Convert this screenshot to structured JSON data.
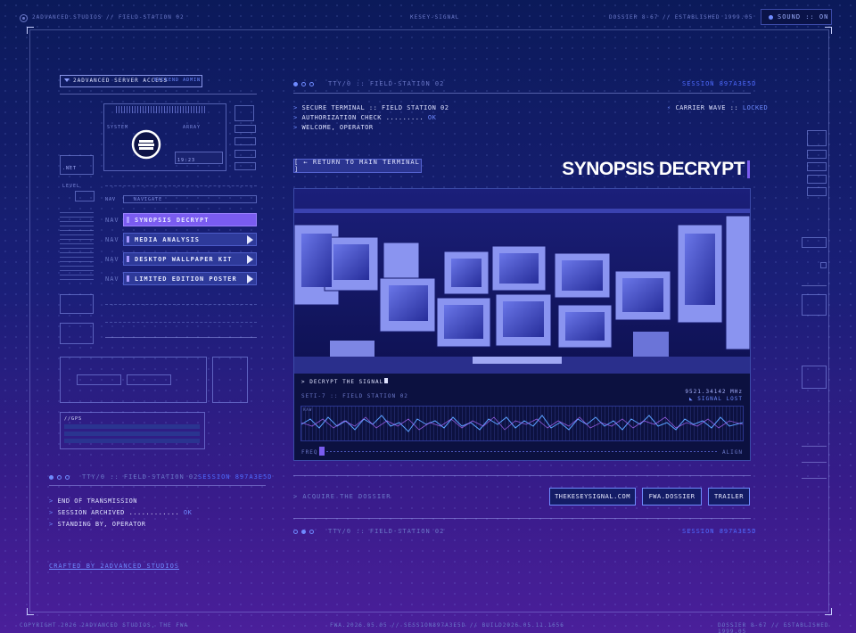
{
  "topbar": {
    "left": "2ADVANCED.STUDIOS  //  FIELD-STATION 02",
    "center": "KESEY-SIGNAL",
    "right": "DOSSIER 8-67  //  ESTABLISHED 1999.05",
    "sound_label": "SOUND :: ON"
  },
  "left_panel": {
    "server_access": "2ADVANCED SERVER ACCESS",
    "backend": "BACKEND ADMIN",
    "system": "SYSTEM",
    "array": "ARRAY",
    "net": ".NET",
    "level": "LEVEL",
    "nav_row_label": "NAVIGATE",
    "nav_row_short": "NAV",
    "nav_label": "NAV",
    "nav_items": [
      {
        "label": "SYNOPSIS DECRYPT",
        "active": true
      },
      {
        "label": "MEDIA ANALYSIS",
        "active": false
      },
      {
        "label": "DESKTOP WALLPAPER KIT",
        "active": false
      },
      {
        "label": "LIMITED EDITION POSTER",
        "active": false
      }
    ],
    "gps": "//GPS",
    "time": "19:23"
  },
  "terminal_top": {
    "head": "TTY/0 :: FIELD-STATION 02",
    "session": "SESSION 897A3E5D",
    "lines": [
      {
        "prefix": ">",
        "text": "SECURE TERMINAL :: FIELD STATION 02",
        "status": ""
      },
      {
        "prefix": ">",
        "text": "AUTHORIZATION CHECK .........",
        "status": "OK"
      },
      {
        "prefix": ">",
        "text": "WELCOME, OPERATOR",
        "status": ""
      }
    ],
    "carrier": "CARRIER WAVE ::",
    "carrier_status": "LOCKED"
  },
  "return_button": "[  ←  RETURN TO MAIN TERMINAL  ]",
  "page_title": "SYNOPSIS DECRYPT",
  "media": {
    "decrypt_label": "> DECRYPT THE SIGNAL",
    "seti": "SETI-7 :: FIELD STATION 02",
    "freq": "9521.34142 MHz",
    "signal_status": "SIGNAL LOST",
    "scope_tag": "RAW",
    "freq_label": "FREQ",
    "align_label": "ALIGN"
  },
  "dossier": {
    "acquire": "> ACQUIRE THE DOSSIER",
    "buttons": [
      "THEKESEYSIGNAL.COM",
      "FWA.DOSSIER",
      "TRAILER"
    ]
  },
  "terminal_left": {
    "head": "TTY/0 :: FIELD-STATION 02",
    "session": "SESSION 897A3E5D",
    "lines": [
      {
        "prefix": ">",
        "text": "END OF TRANSMISSION",
        "status": ""
      },
      {
        "prefix": ">",
        "text": "SESSION ARCHIVED ............",
        "status": "OK"
      },
      {
        "prefix": ">",
        "text": "STANDING BY, OPERATOR",
        "status": ""
      }
    ]
  },
  "terminal_bottom": {
    "head": "TTY/0 :: FIELD-STATION 02",
    "session": "SESSION 897A3E5D"
  },
  "crafted": "CRAFTED BY 2ADVANCED STUDIOS",
  "footer": {
    "left": "COPYRIGHT 2026 2ADVANCED STUDIOS, THE FWA",
    "center": "FWA.2026.05.05  //  SESSION897A3E5D  //  BUILD2026.05.11.1656",
    "right": "DOSSIER 8-67  //  ESTABLISHED 1999.05"
  },
  "colors": {
    "accent": "#6f8bff",
    "active": "#7a5cf0",
    "bg_top": "#0b1a5a",
    "bg_bottom": "#4a1f9a"
  }
}
